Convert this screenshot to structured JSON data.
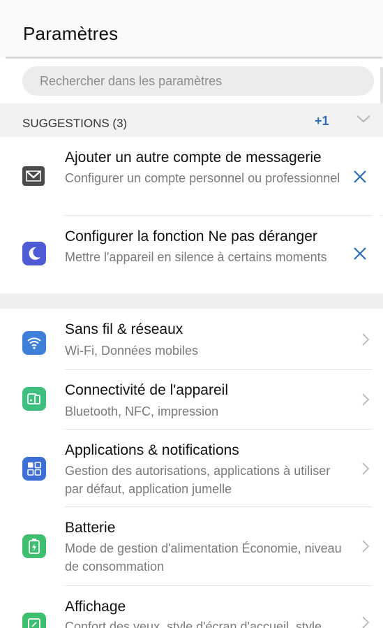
{
  "header": {
    "title": "Paramètres"
  },
  "search": {
    "placeholder": "Rechercher dans les paramètres"
  },
  "suggestions": {
    "title": "SUGGESTIONS (3)",
    "count": "+1",
    "items": [
      {
        "title": "Ajouter un autre compte de messagerie",
        "subtitle": "Configurer un compte personnel ou professionnel",
        "icon": "mail-icon",
        "color": "#4a4a4a"
      },
      {
        "title": "Configurer la fonction Ne pas déranger",
        "subtitle": "Mettre l'appareil en silence à certains moments",
        "icon": "moon-icon",
        "color": "#4f5bd5"
      }
    ]
  },
  "settings": [
    {
      "title": "Sans fil & réseaux",
      "subtitle": "Wi-Fi, Données mobiles",
      "icon": "wifi-icon",
      "color": "#3d7fd9"
    },
    {
      "title": "Connectivité de l'appareil",
      "subtitle": "Bluetooth, NFC, impression",
      "icon": "device-connectivity-icon",
      "color": "#3fbf7f"
    },
    {
      "title": "Applications & notifications",
      "subtitle": "Gestion des autorisations, applications à utiliser par défaut, application jumelle",
      "icon": "apps-grid-icon",
      "color": "#3d6fd6"
    },
    {
      "title": "Batterie",
      "subtitle": "Mode de gestion d'alimentation Économie, niveau de consommation",
      "icon": "battery-icon",
      "color": "#3dbf6f"
    },
    {
      "title": "Affichage",
      "subtitle": "Confort des yeux, style d'écran d'accueil, style",
      "icon": "display-icon",
      "color": "#3dbf6f"
    }
  ]
}
